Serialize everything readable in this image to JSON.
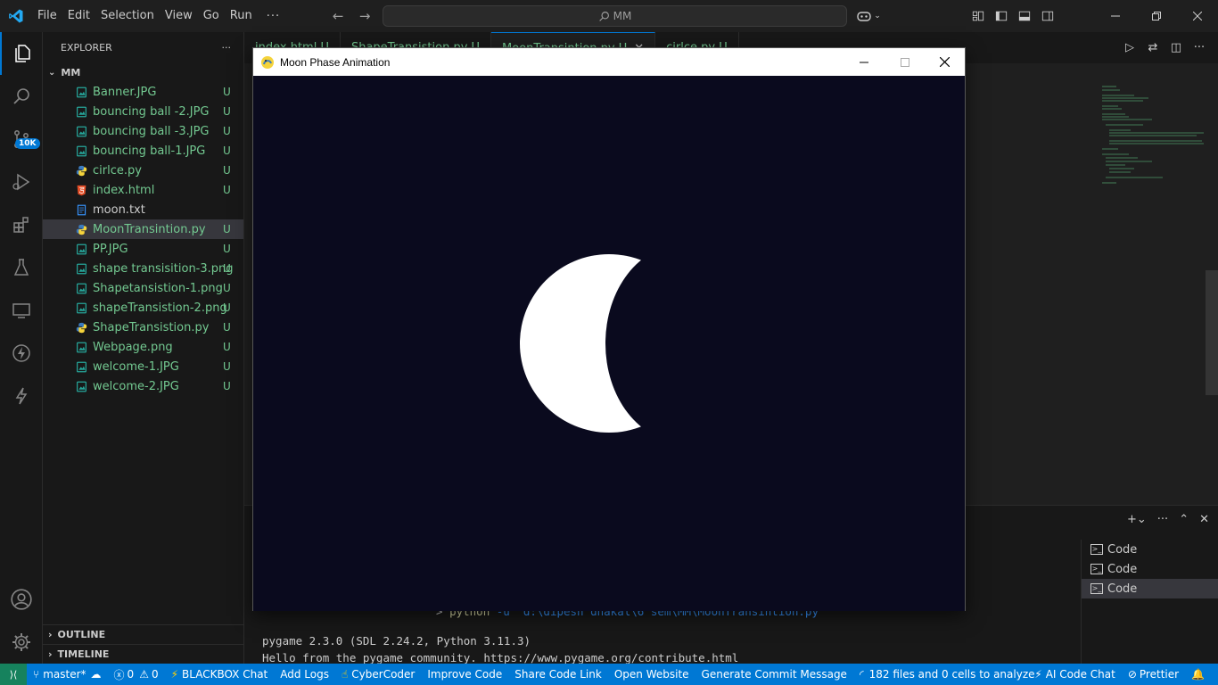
{
  "titlebar": {
    "menus": [
      "File",
      "Edit",
      "Selection",
      "View",
      "Go",
      "Run"
    ],
    "more": "···",
    "search_text": "MM"
  },
  "activity": {
    "scm_badge": "10K"
  },
  "explorer": {
    "title": "EXPLORER",
    "more": "···",
    "folder": "MM",
    "files": [
      {
        "name": "Banner.JPG",
        "status": "U",
        "icon": "image"
      },
      {
        "name": "bouncing ball -2.JPG",
        "status": "U",
        "icon": "image"
      },
      {
        "name": "bouncing ball -3.JPG",
        "status": "U",
        "icon": "image"
      },
      {
        "name": "bouncing ball-1.JPG",
        "status": "U",
        "icon": "image"
      },
      {
        "name": "cirlce.py",
        "status": "U",
        "icon": "python"
      },
      {
        "name": "index.html",
        "status": "U",
        "icon": "html"
      },
      {
        "name": "moon.txt",
        "status": "",
        "icon": "text"
      },
      {
        "name": "MoonTransintion.py",
        "status": "U",
        "icon": "python"
      },
      {
        "name": "PP.JPG",
        "status": "U",
        "icon": "image"
      },
      {
        "name": "shape transisition-3.png",
        "status": "U",
        "icon": "image"
      },
      {
        "name": "Shapetansistion-1.png",
        "status": "U",
        "icon": "image"
      },
      {
        "name": "shapeTransistion-2.png",
        "status": "U",
        "icon": "image"
      },
      {
        "name": "ShapeTransistion.py",
        "status": "U",
        "icon": "python"
      },
      {
        "name": "Webpage.png",
        "status": "U",
        "icon": "image"
      },
      {
        "name": "welcome-1.JPG",
        "status": "U",
        "icon": "image"
      },
      {
        "name": "welcome-2.JPG",
        "status": "U",
        "icon": "image"
      }
    ],
    "outline": "OUTLINE",
    "timeline": "TIMELINE"
  },
  "tabs": [
    {
      "label": "index.html U"
    },
    {
      "label": "ShapeTransistion.py U"
    },
    {
      "label": "MoonTransintion.py U"
    },
    {
      "label": "cirlce.py U"
    }
  ],
  "panel": {
    "terminals": [
      "Code",
      "Code",
      "Code"
    ],
    "cmd_prefix": ">",
    "cmd_python": "python",
    "cmd_args": "-u \"d:\\dipesh dhakal\\6 sem\\MM\\MoonTransintion.py\"",
    "output_lines": [
      "pygame 2.3.0 (SDL 2.24.2, Python 3.11.3)",
      "Hello from the pygame community. https://www.pygame.org/contribute.html"
    ]
  },
  "statusbar": {
    "branch": "master*",
    "errors": "0",
    "warnings": "0",
    "items": [
      "BLACKBOX Chat",
      "Add Logs",
      "CyberCoder",
      "Improve Code",
      "Share Code Link",
      "Open Website",
      "Generate Commit Message"
    ],
    "analyze": "182 files and 0 cells to analyze",
    "ai_chat": "AI Code Chat",
    "prettier": "Prettier"
  },
  "pygame_window": {
    "title": "Moon Phase Animation",
    "background": "#0a0a1e",
    "moon_color": "#ffffff"
  },
  "colors": {
    "accent": "#0078d4",
    "untracked": "#73c991",
    "remote": "#16825d"
  }
}
